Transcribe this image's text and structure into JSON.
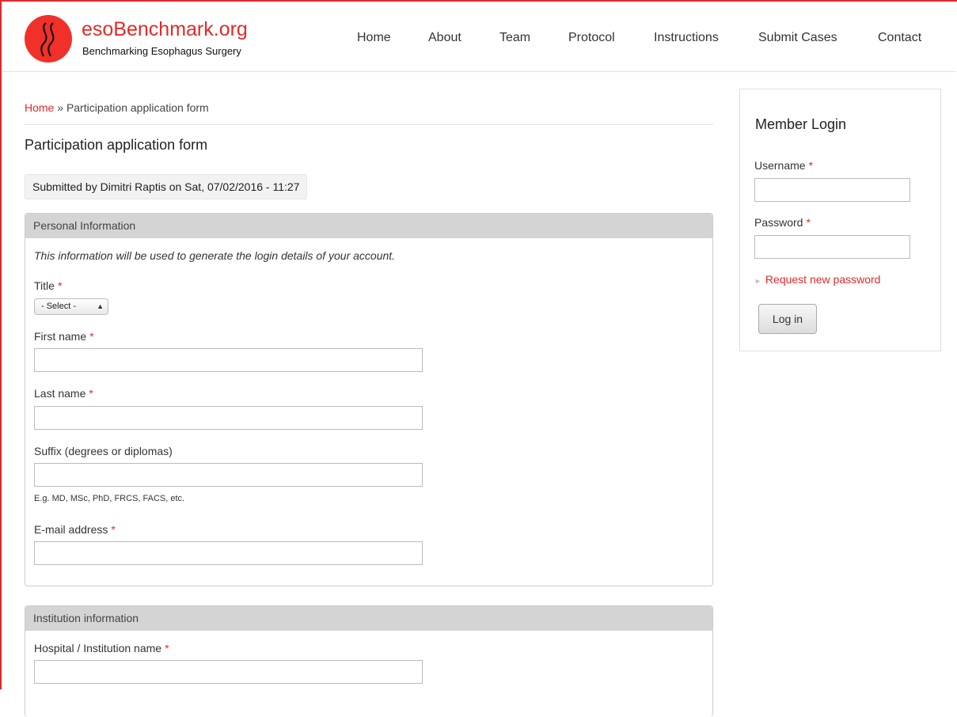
{
  "site": {
    "name": "esoBenchmark.org",
    "slogan": "Benchmarking Esophagus Surgery",
    "accent": "#e12a2a"
  },
  "nav": [
    "Home",
    "About",
    "Team",
    "Protocol",
    "Instructions",
    "Submit Cases",
    "Contact"
  ],
  "breadcrumb": {
    "home": "Home",
    "separator": "»",
    "current": "Participation application form"
  },
  "page_title": "Participation application form",
  "submitted": "Submitted by Dimitri Raptis on Sat, 07/02/2016 - 11:27",
  "personal": {
    "legend": "Personal Information",
    "description": "This information will be used to generate the login details of your account.",
    "title_label": "Title",
    "title_selected": "- Select -",
    "first_name_label": "First name",
    "last_name_label": "Last name",
    "suffix_label": "Suffix (degrees or diplomas)",
    "suffix_hint": "E.g. MD, MSc, PhD, FRCS, FACS, etc.",
    "email_label": "E-mail address",
    "required_mark": "*"
  },
  "institution": {
    "legend": "Institution information",
    "hospital_label": "Hospital / Institution name"
  },
  "login": {
    "title": "Member Login",
    "username_label": "Username",
    "password_label": "Password",
    "request_password": "Request new password",
    "button": "Log in"
  }
}
